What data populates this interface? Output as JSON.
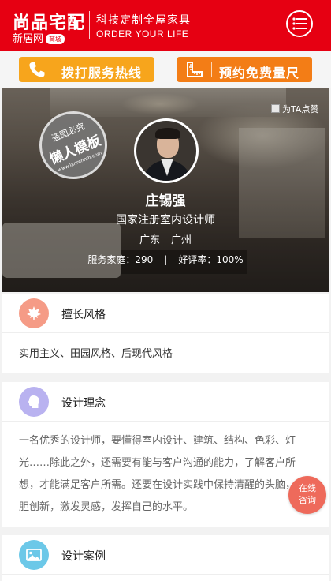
{
  "header": {
    "logo_main": "尚品宅配",
    "logo_sub": "新居网",
    "logo_mall": "商城",
    "slogan_cn": "科技定制全屋家具",
    "slogan_en": "ORDER YOUR LIFE",
    "menu_icon": "list-menu-icon",
    "brand_color": "#e60012"
  },
  "actions": {
    "call_label": "拨打服务热线",
    "measure_label": "预约免费量尺",
    "call_color": "#f7a51c",
    "measure_color": "#f37d16"
  },
  "hero": {
    "watermark_top": "盗图必究",
    "watermark_main": "懒人模板",
    "watermark_url": "www.lanrenmb.com",
    "like_label": "为TA点赞",
    "name": "庄锡强",
    "title": "国家注册室内设计师",
    "province": "广东",
    "city": "广州",
    "service_label": "服务家庭：",
    "service_count": "290",
    "rating_label": "好评率：",
    "rating_value": "100%"
  },
  "sections": {
    "style": {
      "title": "擅长风格",
      "content": "实用主义、田园风格、后现代风格",
      "icon": "maple-leaf-icon",
      "icon_color": "#f59b86"
    },
    "concept": {
      "title": "设计理念",
      "content": "一名优秀的设计师，要懂得室内设计、建筑、结构、色彩、灯光……除此之外，还需要有能与客户沟通的能力，了解客户所想，才能满足客户所需。还要在设计实践中保持清醒的头脑，大胆创新，激发灵感，发挥自己的水平。",
      "icon": "head-profile-icon",
      "icon_color": "#b9b2f0"
    },
    "cases": {
      "title": "设计案例",
      "icon": "picture-icon",
      "icon_color": "#6cc8e8"
    }
  },
  "float": {
    "line1": "在线",
    "line2": "咨询",
    "color": "#ee6a5b"
  }
}
